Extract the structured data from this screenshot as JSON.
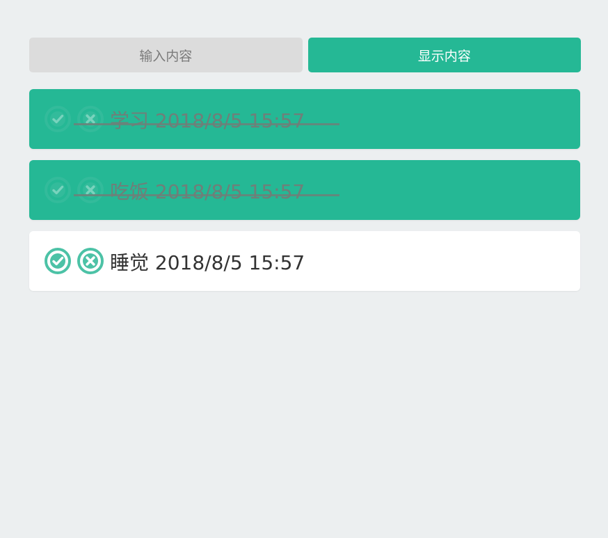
{
  "tabs": {
    "input_label": "输入内容",
    "display_label": "显示内容"
  },
  "todo": {
    "items": [
      {
        "text": "学习 2018/8/5 15:57",
        "done": true
      },
      {
        "text": "吃饭 2018/8/5 15:57",
        "done": true
      },
      {
        "text": "睡觉 2018/8/5 15:57",
        "done": false
      }
    ]
  },
  "colors": {
    "accent": "#25b895",
    "icon": "#4cc2a6",
    "background": "#eceff0"
  },
  "icons": {
    "complete": "check-circle-icon",
    "delete": "x-circle-icon"
  }
}
